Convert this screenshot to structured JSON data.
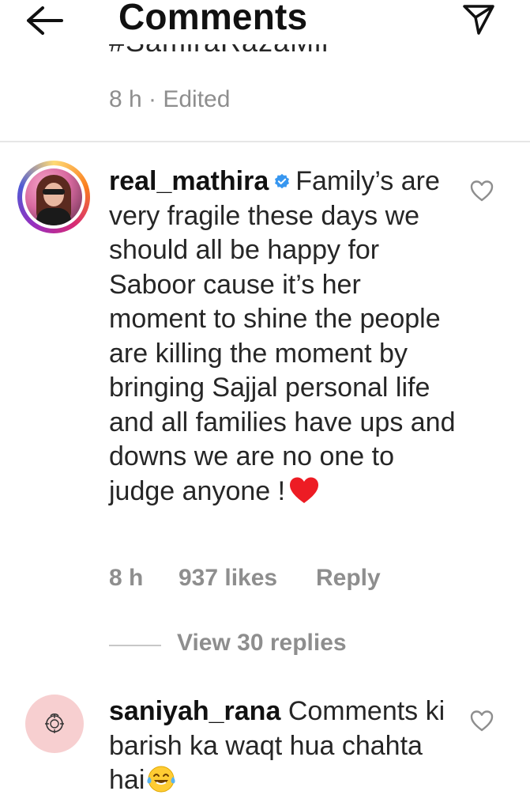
{
  "header": {
    "title": "Comments",
    "back_icon": "arrow-left-icon",
    "send_icon": "paper-plane-icon"
  },
  "caption": {
    "clipped_text": "#SamiraRazaMir",
    "meta": "8 h · Edited"
  },
  "comments": [
    {
      "username": "real_mathira",
      "verified": true,
      "text": "Family’s are very fragile these days we should all be happy for Saboor cause it’s her moment to shine the people are killing the moment by bringing Sajjal personal life and all families have ups and downs we are no one to judge anyone !",
      "emoji": "heart-emoji",
      "time": "8 h",
      "likes": "937 likes",
      "reply_label": "Reply",
      "view_replies": "View 30 replies"
    },
    {
      "username": "saniyah_rana",
      "verified": false,
      "text": "Comments ki barish ka waqt hua chahta hai",
      "emoji": "laughing-tears-emoji"
    }
  ],
  "colors": {
    "text_primary": "#262626",
    "text_secondary": "#8e8e8e",
    "verified_blue": "#3897f0",
    "heart_red": "#ed1c24"
  }
}
